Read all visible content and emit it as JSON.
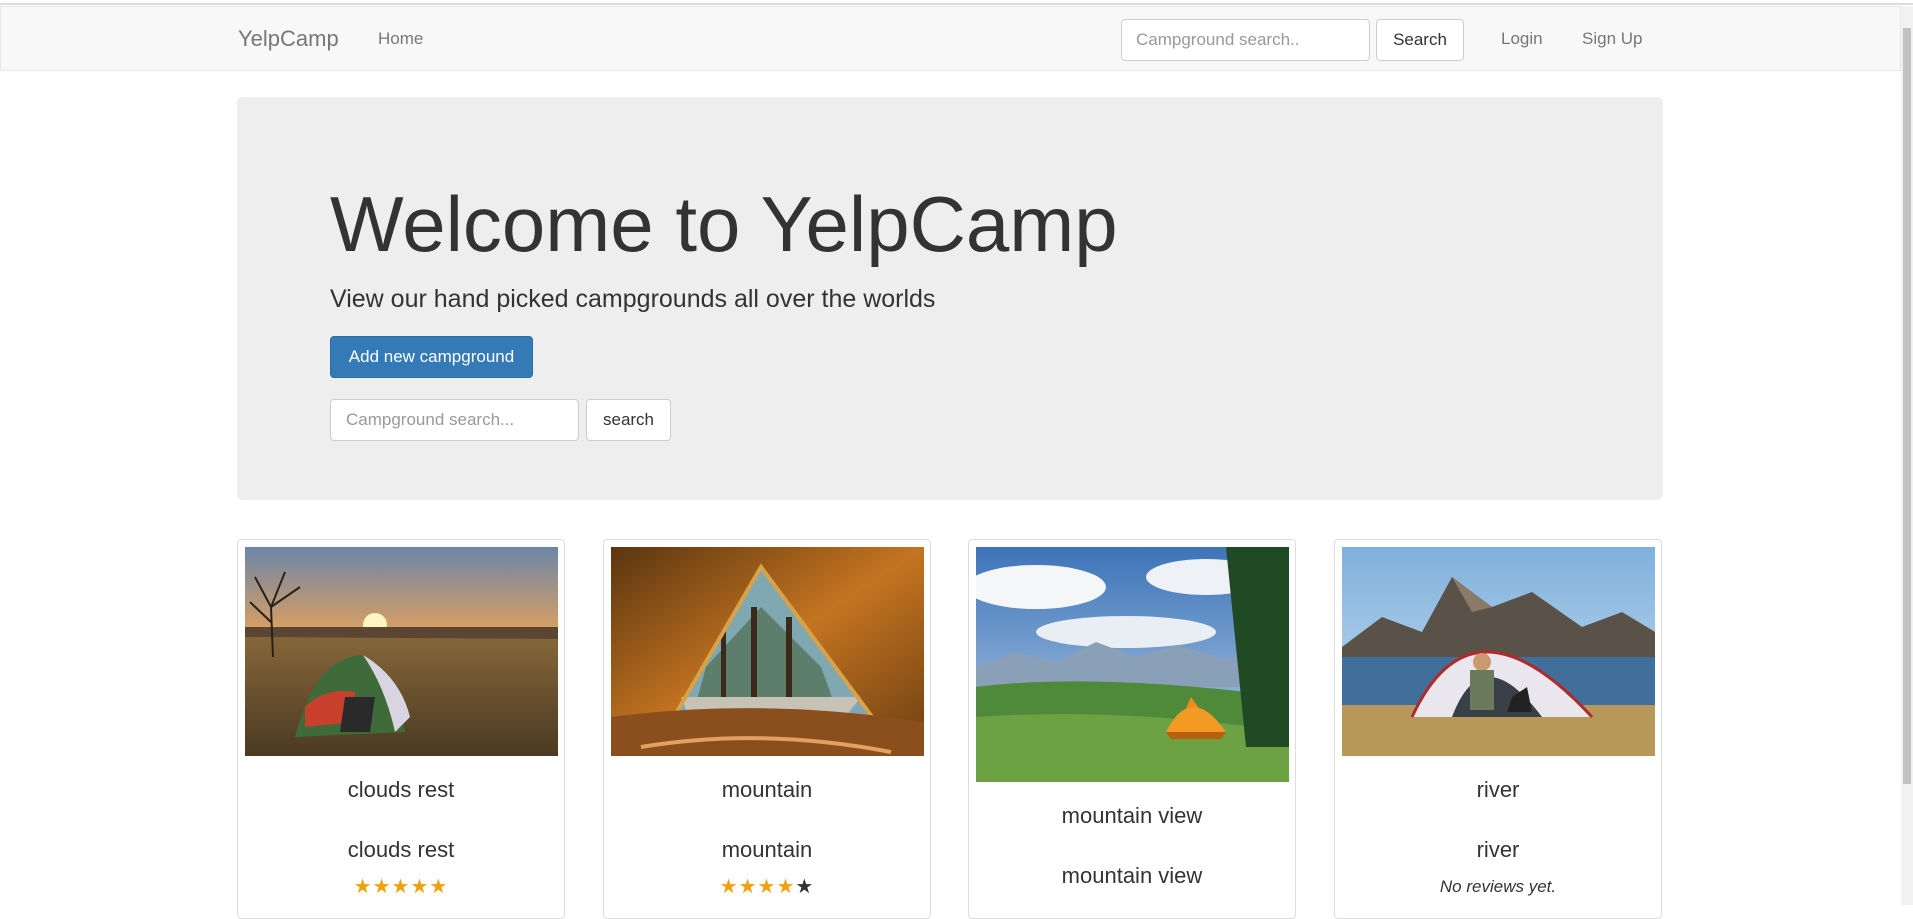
{
  "navbar": {
    "brand": "YelpCamp",
    "home": "Home",
    "search_placeholder": "Campground search..",
    "search_button": "Search",
    "login": "Login",
    "signup": "Sign Up"
  },
  "jumbotron": {
    "title": "Welcome to YelpCamp",
    "subtitle": "View our hand picked campgrounds all over the worlds",
    "add_button": "Add new campground",
    "search_placeholder": "Campground search...",
    "search_button": "search"
  },
  "campgrounds": [
    {
      "name": "clouds rest",
      "caption": "clouds rest",
      "rating": 5,
      "reviews_text": ""
    },
    {
      "name": "mountain",
      "caption": "mountain",
      "rating": 4,
      "reviews_text": ""
    },
    {
      "name": "mountain view",
      "caption": "mountain view",
      "rating": null,
      "reviews_text": ""
    },
    {
      "name": "river",
      "caption": "river",
      "rating": null,
      "reviews_text": "No reviews yet."
    }
  ],
  "colors": {
    "primary": "#337ab7",
    "star": "#f0a20e",
    "jumbotron_bg": "#eeeeee",
    "navbar_bg": "#f8f8f8"
  }
}
